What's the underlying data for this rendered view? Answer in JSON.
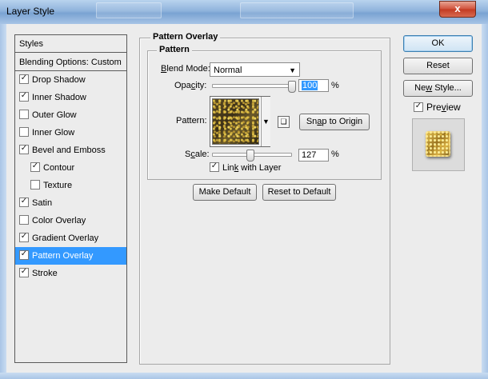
{
  "window": {
    "title": "Layer Style",
    "close_glyph": "x"
  },
  "styles_list": {
    "header": "Styles",
    "blending": "Blending Options: Custom",
    "items": [
      {
        "label": "Drop Shadow",
        "checked": true,
        "indent": false,
        "selected": false
      },
      {
        "label": "Inner Shadow",
        "checked": true,
        "indent": false,
        "selected": false
      },
      {
        "label": "Outer Glow",
        "checked": false,
        "indent": false,
        "selected": false
      },
      {
        "label": "Inner Glow",
        "checked": false,
        "indent": false,
        "selected": false
      },
      {
        "label": "Bevel and Emboss",
        "checked": true,
        "indent": false,
        "selected": false
      },
      {
        "label": "Contour",
        "checked": true,
        "indent": true,
        "selected": false
      },
      {
        "label": "Texture",
        "checked": false,
        "indent": true,
        "selected": false
      },
      {
        "label": "Satin",
        "checked": true,
        "indent": false,
        "selected": false
      },
      {
        "label": "Color Overlay",
        "checked": false,
        "indent": false,
        "selected": false
      },
      {
        "label": "Gradient Overlay",
        "checked": true,
        "indent": false,
        "selected": false
      },
      {
        "label": "Pattern Overlay",
        "checked": true,
        "indent": false,
        "selected": true
      },
      {
        "label": "Stroke",
        "checked": true,
        "indent": false,
        "selected": false
      }
    ]
  },
  "pattern_overlay": {
    "group_title": "Pattern Overlay",
    "sub_group_title": "Pattern",
    "blend_mode_label_prefix": "B",
    "blend_mode_label_rest": "lend Mode:",
    "blend_mode_value": "Normal",
    "opacity_label_prefix": "Opa",
    "opacity_label_u": "c",
    "opacity_label_rest": "ity:",
    "opacity_value": "100",
    "opacity_unit": "%",
    "opacity_level": 100,
    "pattern_label": "Pattern:",
    "snap_button_prefix": "Sn",
    "snap_button_u": "a",
    "snap_button_rest": "p to Origin",
    "scale_label_prefix": "S",
    "scale_label_u": "c",
    "scale_label_rest": "ale:",
    "scale_value": "127",
    "scale_unit": "%",
    "scale_level": 127,
    "link_label_prefix": "Lin",
    "link_label_u": "k",
    "link_label_rest": " with Layer",
    "link_checked": true,
    "make_default": "Make Default",
    "reset_default": "Reset to Default"
  },
  "actions": {
    "ok": "OK",
    "reset": "Reset",
    "new_style_prefix": "Ne",
    "new_style_u": "w",
    "new_style_rest": " Style...",
    "preview_prefix": "Pre",
    "preview_u": "v",
    "preview_rest": "iew",
    "preview_checked": true
  },
  "colors": {
    "selection": "#3399ff",
    "titlebar": "#8fb3dc",
    "close": "#c23a22",
    "pattern_gold": "#c9a83a"
  }
}
